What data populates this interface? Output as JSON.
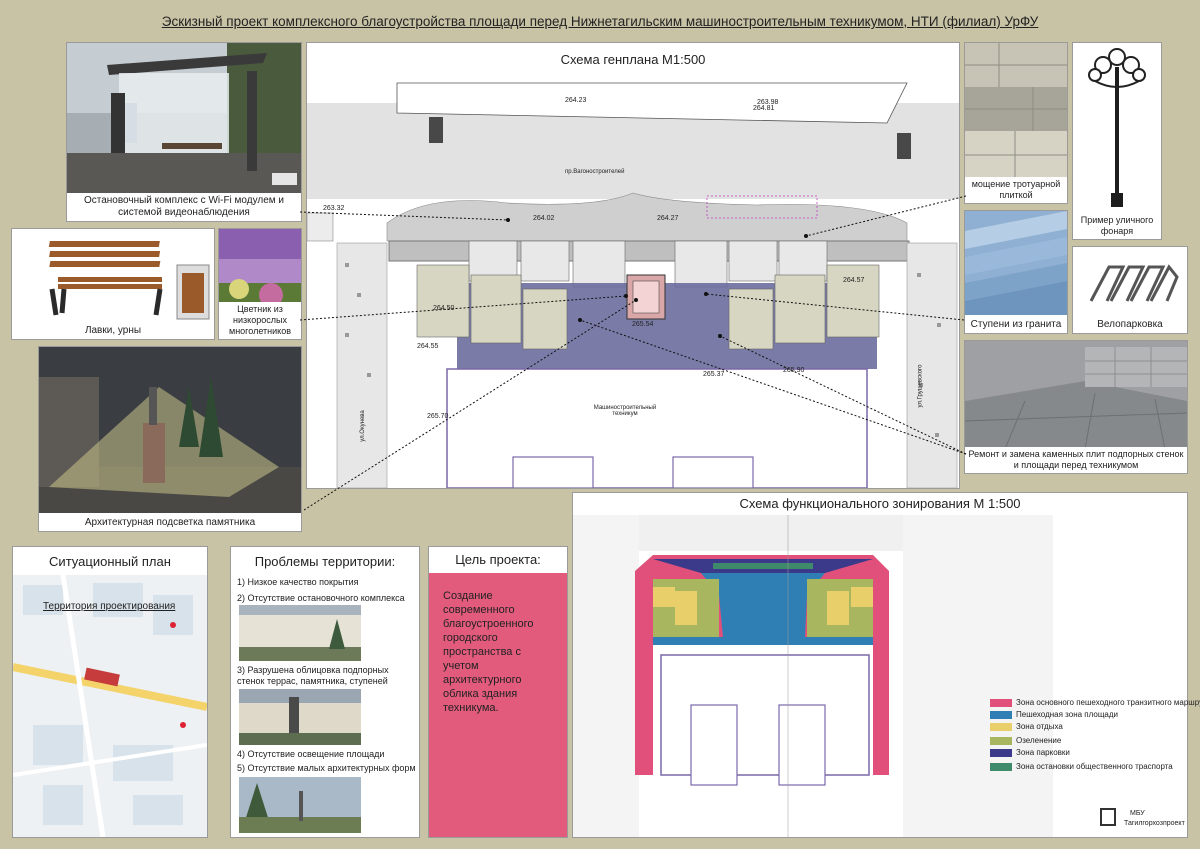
{
  "title": "Эскизный проект комплексного благоустройства площади перед Нижнетагильским машиностроительным техникумом, НТИ (филиал) УрФУ",
  "genplan": {
    "title": "Схема генплана М1:500",
    "street_label": "пр.Вагоностроителей",
    "building_label": "Машиностроительный техникум",
    "side_street_left": "ул.Окунева",
    "side_street_right": "ул.Грушевского",
    "elevations": [
      "263.32",
      "264.23",
      "264.02",
      "264.27",
      "263.98",
      "264.81",
      "264.50",
      "264.57",
      "265.37",
      "265.90",
      "265.70",
      "264.55",
      "265.54"
    ]
  },
  "captions": {
    "bus_stop": "Остановочный комплекс с Wi-Fi модулем и системой видеонаблюдения",
    "benches": "Лавки, урны",
    "flowerbed": "Цветник из низкорослых многолетников",
    "monument": "Архитектурная подсветка памятника",
    "paving": "мощение тротуарной плиткой",
    "lamp": "Пример уличного фонаря",
    "granite_steps": "Ступени из гранита",
    "bike_parking": "Велопарковка",
    "repair": "Ремонт и замена каменных плит подпорных стенок и площади перед техникумом"
  },
  "situation": {
    "title": "Ситуационный план",
    "label": "Территория проектирования"
  },
  "problems": {
    "title": "Проблемы территории:",
    "items": [
      "1)  Низкое качество покрытия",
      "2)  Отсутствие остановочного комплекса",
      "3) Разрушена облицовка подпорных стенок террас, памятника, ступеней",
      "4) Отсутствие освещение площади",
      "5)  Отсутствие малых архитектурных форм"
    ]
  },
  "goal": {
    "title": "Цель проекта:",
    "text": "Создание современного благоустроенного городского пространства с учетом архитектурного облика здания техникума."
  },
  "zoning": {
    "title": "Схема функционального зонирования М 1:500",
    "legend": [
      {
        "label": "Зона основного пешеходного транзитного маршрута",
        "color": "#e0507a"
      },
      {
        "label": "Пешеходная зона площади",
        "color": "#2f7fb5"
      },
      {
        "label": "Зона отдыха",
        "color": "#e9cf6a"
      },
      {
        "label": "Озеленение",
        "color": "#a8b75f"
      },
      {
        "label": "Зона парковки",
        "color": "#3b3a8a"
      },
      {
        "label": "Зона остановки общественного траспорта",
        "color": "#3f8a6a"
      }
    ],
    "stamp_line1": "МБУ",
    "stamp_line2": "Тагилгорхозпроект"
  },
  "colors": {
    "background": "#c9c3a6",
    "goal_panel": "#e25b7c",
    "accent_plaza": "#6d6d9e"
  }
}
